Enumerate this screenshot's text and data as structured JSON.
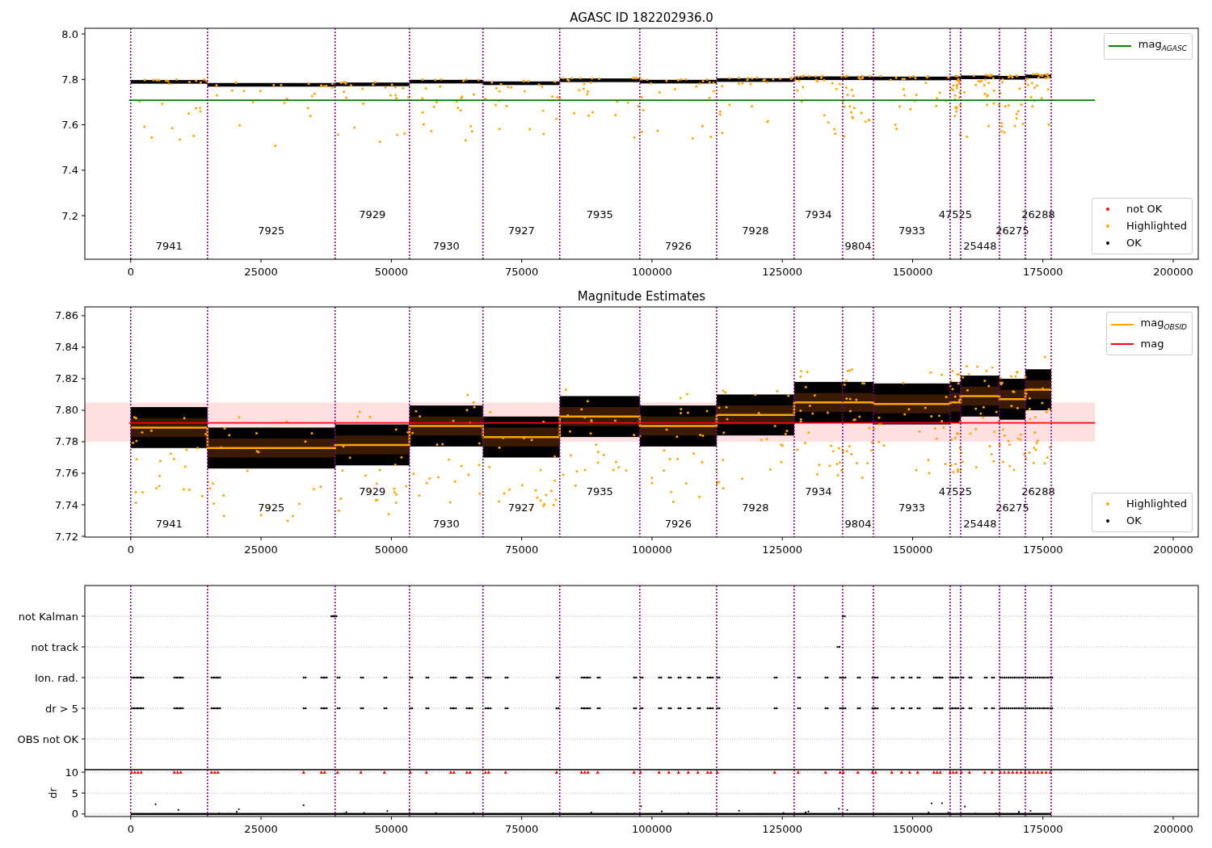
{
  "panels": [
    {
      "kind": "mag",
      "title": "AGASC ID 182202936.0",
      "chart_data": {
        "type": "scatter",
        "xlim": [
          -8800,
          204800
        ],
        "ylim": [
          7.008,
          8.025
        ],
        "xticks": [
          {
            "value": 0,
            "label": "0"
          },
          {
            "value": 25000,
            "label": "25000"
          },
          {
            "value": 50000,
            "label": "50000"
          },
          {
            "value": 75000,
            "label": "75000"
          },
          {
            "value": 100000,
            "label": "100000"
          },
          {
            "value": 125000,
            "label": "125000"
          },
          {
            "value": 150000,
            "label": "150000"
          },
          {
            "value": 175000,
            "label": "175000"
          },
          {
            "value": 200000,
            "label": "200000"
          }
        ],
        "yticks": [
          {
            "value": 7.2,
            "label": "7.2"
          },
          {
            "value": 7.4,
            "label": "7.4"
          },
          {
            "value": 7.6,
            "label": "7.6"
          },
          {
            "value": 7.8,
            "label": "7.8"
          },
          {
            "value": 8.0,
            "label": "8.0"
          }
        ],
        "ref_lines": [
          {
            "axis": "x",
            "value": 0
          },
          {
            "axis": "x",
            "value": 14730
          },
          {
            "axis": "x",
            "value": 39220
          },
          {
            "axis": "x",
            "value": 53480
          },
          {
            "axis": "x",
            "value": 67580
          },
          {
            "axis": "x",
            "value": 82310
          },
          {
            "axis": "x",
            "value": 97670
          },
          {
            "axis": "x",
            "value": 112400
          },
          {
            "axis": "x",
            "value": 127280
          },
          {
            "axis": "x",
            "value": 136580
          },
          {
            "axis": "x",
            "value": 142480
          },
          {
            "axis": "x",
            "value": 157200
          },
          {
            "axis": "x",
            "value": 159220
          },
          {
            "axis": "x",
            "value": 166660
          },
          {
            "axis": "x",
            "value": 171630
          },
          {
            "axis": "x",
            "value": 176590
          },
          {
            "axis": "y",
            "value": 7.708,
            "label": "mag$_{AGASC}$",
            "color": "#008000"
          }
        ],
        "annotations": [
          "7941",
          "7925",
          "7929",
          "7930",
          "7927",
          "7935",
          "7926",
          "7928",
          "7934",
          "9804",
          "7933",
          "47525",
          "25448",
          "26275",
          "26288"
        ]
      },
      "legends": [
        {
          "items": [
            {
              "label": "not OK",
              "color": "#ff0000"
            },
            {
              "label": "Highlighted",
              "color": "#ffa500"
            },
            {
              "label": "OK",
              "color": "#000000"
            }
          ]
        }
      ]
    },
    {
      "kind": "mag",
      "title": "Magnitude Estimates",
      "chart_data": {
        "type": "line",
        "xlim": [
          -8800,
          204800
        ],
        "ylim": [
          7.7195,
          7.8656
        ],
        "xticks": [
          {
            "value": 0,
            "label": "0"
          },
          {
            "value": 25000,
            "label": "25000"
          },
          {
            "value": 50000,
            "label": "50000"
          },
          {
            "value": 75000,
            "label": "75000"
          },
          {
            "value": 100000,
            "label": "100000"
          },
          {
            "value": 125000,
            "label": "125000"
          },
          {
            "value": 150000,
            "label": "150000"
          },
          {
            "value": 175000,
            "label": "175000"
          },
          {
            "value": 200000,
            "label": "200000"
          }
        ],
        "yticks": [
          {
            "value": 7.72,
            "label": "7.72"
          },
          {
            "value": 7.74,
            "label": "7.74"
          },
          {
            "value": 7.76,
            "label": "7.76"
          },
          {
            "value": 7.78,
            "label": "7.78"
          },
          {
            "value": 7.8,
            "label": "7.80"
          },
          {
            "value": 7.82,
            "label": "7.82"
          },
          {
            "value": 7.84,
            "label": "7.84"
          },
          {
            "value": 7.86,
            "label": "7.86"
          }
        ],
        "series": [
          {
            "name": "mag$_{OBSID}$",
            "color": "#ffa500",
            "x": [
              0,
              14730,
              14730,
              39220,
              39220,
              53480,
              53480,
              67580,
              67580,
              82310,
              82310,
              97670,
              97670,
              112400,
              112400,
              127280,
              127280,
              136580,
              136580,
              142480,
              142480,
              157200,
              157200,
              159220,
              159220,
              166660,
              166660,
              171630,
              171630,
              176590
            ],
            "values": [
              7.789,
              7.789,
              7.776,
              7.776,
              7.778,
              7.778,
              7.79,
              7.79,
              7.783,
              7.783,
              7.796,
              7.796,
              7.79,
              7.79,
              7.797,
              7.797,
              7.805,
              7.805,
              7.805,
              7.805,
              7.804,
              7.804,
              7.805,
              7.805,
              7.809,
              7.809,
              7.807,
              7.807,
              7.813,
              7.813
            ]
          }
        ],
        "ref_lines": [
          {
            "axis": "x",
            "value": 0
          },
          {
            "axis": "x",
            "value": 14730
          },
          {
            "axis": "x",
            "value": 39220
          },
          {
            "axis": "x",
            "value": 53480
          },
          {
            "axis": "x",
            "value": 67580
          },
          {
            "axis": "x",
            "value": 82310
          },
          {
            "axis": "x",
            "value": 97670
          },
          {
            "axis": "x",
            "value": 112400
          },
          {
            "axis": "x",
            "value": 127280
          },
          {
            "axis": "x",
            "value": 136580
          },
          {
            "axis": "x",
            "value": 142480
          },
          {
            "axis": "x",
            "value": 157200
          },
          {
            "axis": "x",
            "value": 159220
          },
          {
            "axis": "x",
            "value": 166660
          },
          {
            "axis": "x",
            "value": 171630
          },
          {
            "axis": "x",
            "value": 176590
          },
          {
            "axis": "y",
            "value": 7.792,
            "label": "mag",
            "color": "#ff0000"
          }
        ],
        "bands": [
          {
            "axis": "y",
            "from": 7.78,
            "to": 7.805,
            "color": "#ffcccc"
          }
        ],
        "annotations": [
          "7941",
          "7925",
          "7929",
          "7930",
          "7927",
          "7935",
          "7926",
          "7928",
          "7934",
          "9804",
          "7933",
          "47525",
          "25448",
          "26275",
          "26288"
        ]
      },
      "legends": [
        {
          "items": [
            {
              "label": "Highlighted",
              "color": "#ffa500"
            },
            {
              "label": "OK",
              "color": "#000000"
            }
          ]
        }
      ]
    },
    {
      "kind": "flags",
      "rows": [
        {
          "label": "not Kalman"
        },
        {
          "label": "not track"
        },
        {
          "label": "Ion. rad."
        },
        {
          "label": "dr > 5"
        },
        {
          "label": "OBS not OK"
        }
      ]
    },
    {
      "kind": "dr",
      "chart_data": {
        "type": "scatter",
        "xlim": [
          -8800,
          204800
        ],
        "ylim": [
          -0.6,
          10.6
        ],
        "ylabel": "dr",
        "grid": true,
        "ref_lines": [
          {
            "axis": "x",
            "value": 0
          },
          {
            "axis": "x",
            "value": 14730
          },
          {
            "axis": "x",
            "value": 39220
          },
          {
            "axis": "x",
            "value": 53480
          },
          {
            "axis": "x",
            "value": 67580
          },
          {
            "axis": "x",
            "value": 82310
          },
          {
            "axis": "x",
            "value": 97670
          },
          {
            "axis": "x",
            "value": 112400
          },
          {
            "axis": "x",
            "value": 127280
          },
          {
            "axis": "x",
            "value": 136580
          },
          {
            "axis": "x",
            "value": 142480
          },
          {
            "axis": "x",
            "value": 157200
          },
          {
            "axis": "x",
            "value": 159220
          },
          {
            "axis": "x",
            "value": 166660
          },
          {
            "axis": "x",
            "value": 171630
          },
          {
            "axis": "x",
            "value": 176590
          }
        ],
        "xticks": [
          {
            "value": 0,
            "label": "0"
          },
          {
            "value": 25000,
            "label": "25000"
          },
          {
            "value": 50000,
            "label": "50000"
          },
          {
            "value": 75000,
            "label": "75000"
          },
          {
            "value": 100000,
            "label": "100000"
          },
          {
            "value": 125000,
            "label": "125000"
          },
          {
            "value": 150000,
            "label": "150000"
          },
          {
            "value": 175000,
            "label": "175000"
          },
          {
            "value": 200000,
            "label": "200000"
          }
        ],
        "yticks": [
          {
            "value": 0,
            "label": "0"
          },
          {
            "value": 5,
            "label": "5"
          },
          {
            "value": 10,
            "label": "10"
          }
        ],
        "series": [
          {
            "color": "#ff0000",
            "x": [
              155,
              775,
              1395,
              2015,
              8370,
              8990,
              9610,
              15500,
              16120,
              16740,
              33170,
              36580,
              37200,
              39680,
              44175,
              48670,
              53630,
              56730,
              61380,
              62000,
              64480,
              65100,
              68045,
              68665,
              71920,
              81685,
              86490,
              87110,
              87730,
              89590,
              96565,
              97805,
              101370,
              103230,
              105090,
              106950,
              108810,
              110670,
              111290,
              112530,
              123535,
              128030,
              133300,
              136090,
              136710,
              139500,
              142290,
              142910,
              146010,
              147870,
              149420,
              150970,
              154070,
              154690,
              155310,
              157170,
              157790,
              158410,
              159340,
              160890,
              163835,
              165230,
              166800,
              167600,
              168400,
              169200,
              170000,
              170800,
              171600,
              172400,
              173200,
              174000,
              174800,
              175600,
              176400
            ],
            "values": [
              10,
              10,
              10,
              10,
              10,
              10,
              10,
              10,
              10,
              10,
              10,
              10,
              10,
              10,
              10,
              10,
              10,
              10,
              10,
              10,
              10,
              10,
              10,
              10,
              10,
              10,
              10,
              10,
              10,
              10,
              10,
              10,
              10,
              10,
              10,
              10,
              10,
              10,
              10,
              10,
              10,
              10,
              10,
              10,
              10,
              10,
              10,
              10,
              10,
              10,
              10,
              10,
              10,
              10,
              10,
              10,
              10,
              10,
              10,
              10,
              10,
              10,
              10,
              10,
              10,
              10,
              10,
              10,
              10,
              10,
              10,
              10,
              10,
              10,
              10
            ]
          }
        ]
      }
    }
  ]
}
